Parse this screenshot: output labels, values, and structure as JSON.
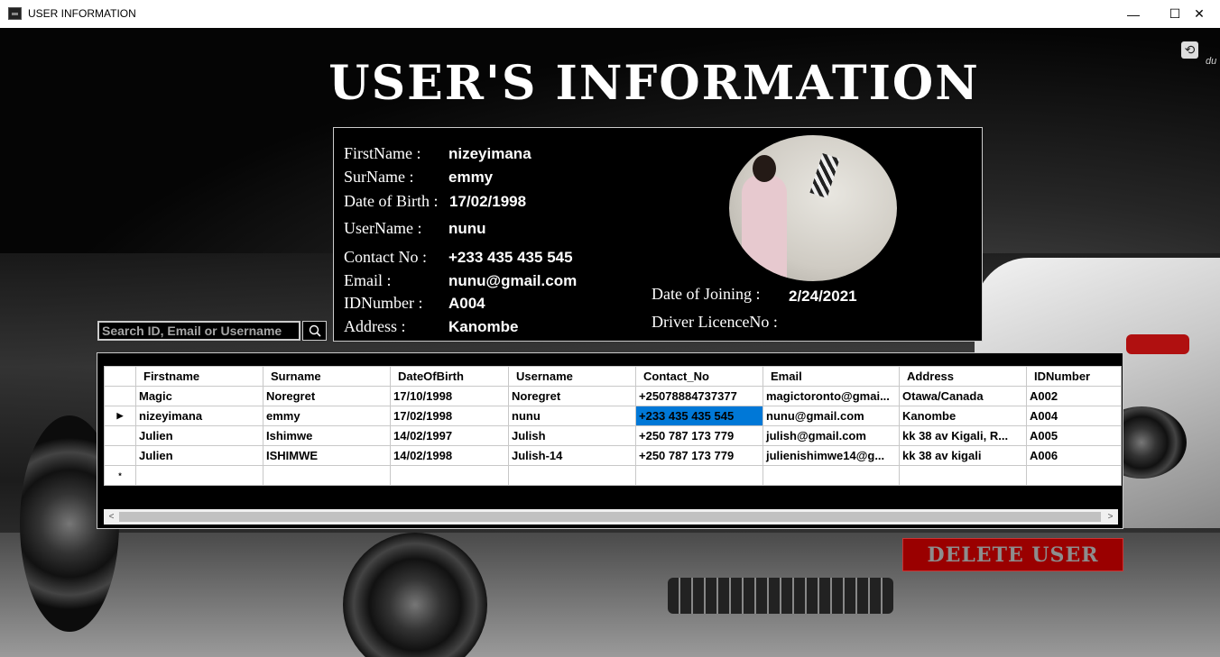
{
  "window": {
    "title": "USER INFORMATION",
    "minimize": "—",
    "maximize": "☐",
    "close": "✕"
  },
  "page": {
    "heading": "USER'S INFORMATION",
    "refresh_icon": "⟲",
    "corner_text": "du"
  },
  "profile": {
    "firstname_label": "FirstName :",
    "firstname": "nizeyimana",
    "surname_label": "SurName :",
    "surname": "emmy",
    "dob_label": "Date of Birth :",
    "dob": "17/02/1998",
    "username_label": "UserName :",
    "username": "nunu",
    "contact_label": "Contact No :",
    "contact": "+233 435 435 545",
    "email_label": "Email :",
    "email": "nunu@gmail.com",
    "idnumber_label": "IDNumber :",
    "idnumber": "A004",
    "address_label": "Address :",
    "address": "Kanombe",
    "joining_label": "Date of Joining :",
    "joining": "2/24/2021",
    "licence_label": "Driver LicenceNo :",
    "licence": ""
  },
  "search": {
    "placeholder": "Search ID, Email or Username",
    "icon": "search-icon"
  },
  "grid": {
    "columns": [
      "Firstname",
      "Surname",
      "DateOfBirth",
      "Username",
      "Contact_No",
      "Email",
      "Address",
      "IDNumber"
    ],
    "rows": [
      {
        "marker": "",
        "cells": [
          "Magic",
          "Noregret",
          "17/10/1998",
          "Noregret",
          "+25078884737377",
          "magictoronto@gmai...",
          "Otawa/Canada",
          "A002"
        ]
      },
      {
        "marker": "▶",
        "cells": [
          "nizeyimana",
          "emmy",
          "17/02/1998",
          "nunu",
          "+233 435 435 545",
          "nunu@gmail.com",
          "Kanombe",
          "A004"
        ]
      },
      {
        "marker": "",
        "cells": [
          "Julien",
          "Ishimwe",
          "14/02/1997",
          "Julish",
          "+250 787 173 779",
          "julish@gmail.com",
          "kk 38 av Kigali, R...",
          "A005"
        ]
      },
      {
        "marker": "",
        "cells": [
          "Julien",
          "ISHIMWE",
          "14/02/1998",
          "Julish-14",
          "+250 787 173 779",
          "julienishimwe14@g...",
          "kk 38 av kigali",
          "A006"
        ]
      }
    ],
    "new_row_marker": "*",
    "selected_cell": {
      "row": 1,
      "col": 4
    }
  },
  "scroll": {
    "left": "<",
    "right": ">"
  },
  "actions": {
    "delete_label": "DELETE USER"
  }
}
